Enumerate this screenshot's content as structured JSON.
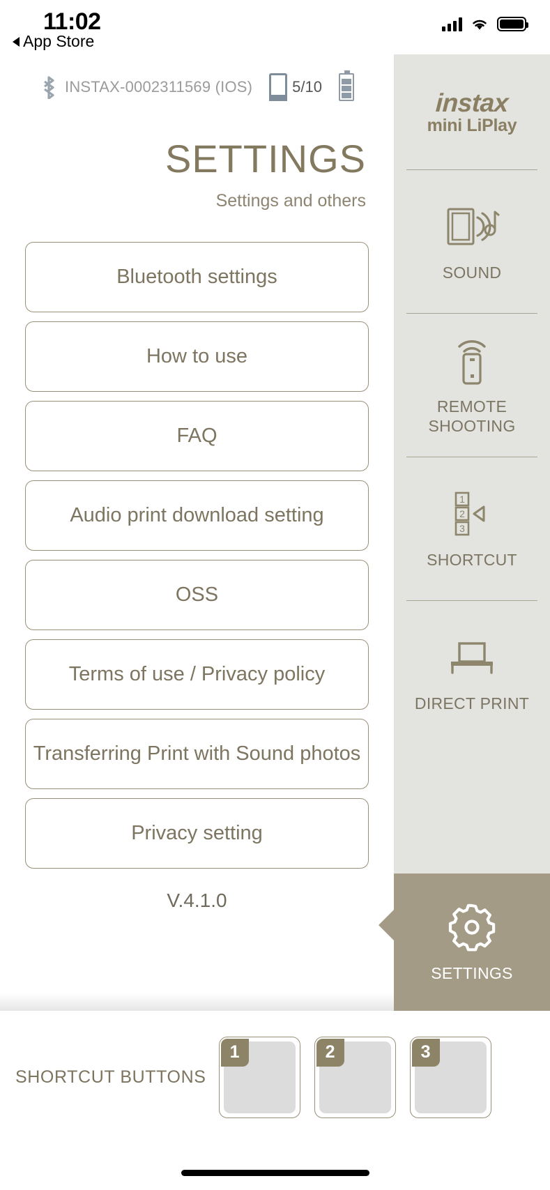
{
  "status_bar": {
    "time": "11:02",
    "back_label": "App Store",
    "icons": {
      "signal": "cellular-bars-icon",
      "wifi": "wifi-icon",
      "battery": "battery-icon"
    }
  },
  "device_status": {
    "bluetooth_icon": "bluetooth-icon",
    "device_name": "INSTAX-0002311569 (IOS)",
    "film_icon": "film-pack-icon",
    "film_count": "5/10",
    "battery_icon": "device-battery-icon"
  },
  "main": {
    "title": "SETTINGS",
    "subtitle": "Settings and others",
    "version": "V.4.1.0",
    "menu": [
      {
        "label": "Bluetooth settings"
      },
      {
        "label": "How to use"
      },
      {
        "label": "FAQ"
      },
      {
        "label": "Audio print download setting"
      },
      {
        "label": "OSS"
      },
      {
        "label": "Terms of use / Privacy policy"
      },
      {
        "label": "Transferring Print with Sound photos"
      },
      {
        "label": "Privacy setting"
      }
    ]
  },
  "sidebar": {
    "logo_main": "instax",
    "logo_sub": "mini LiPlay",
    "items": [
      {
        "label": "SOUND",
        "icon": "photo-sound-icon",
        "active": false
      },
      {
        "label": "REMOTE\nSHOOTING",
        "label_line1": "REMOTE",
        "label_line2": "SHOOTING",
        "icon": "remote-control-icon",
        "active": false
      },
      {
        "label": "SHORTCUT",
        "icon": "shortcut-numbers-icon",
        "active": false
      },
      {
        "label": "DIRECT PRINT",
        "icon": "printer-icon",
        "active": false
      },
      {
        "label": "SETTINGS",
        "icon": "gear-icon",
        "active": true
      }
    ]
  },
  "shortcut_bar": {
    "label": "SHORTCUT BUTTONS",
    "slots": [
      {
        "number": "1"
      },
      {
        "number": "2"
      },
      {
        "number": "3"
      }
    ]
  },
  "colors": {
    "accent": "#82795f",
    "sidebar_bg": "#e3e4df",
    "active_tab": "#a39b86",
    "border": "#9a9078",
    "slot_fill": "#dcdcdc"
  }
}
